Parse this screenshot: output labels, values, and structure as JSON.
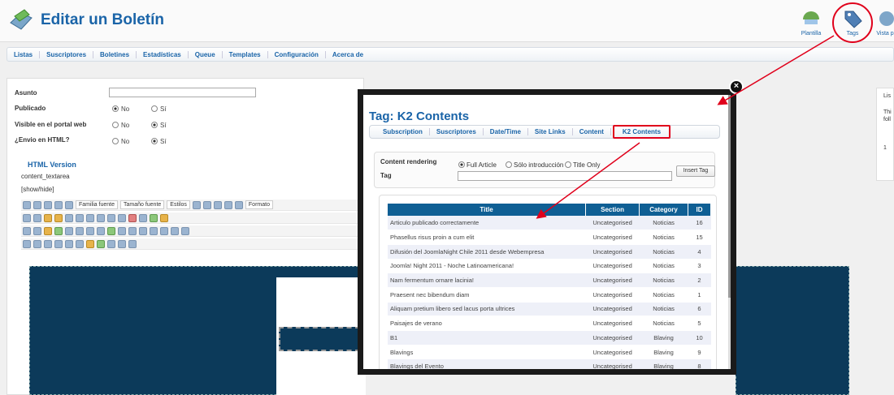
{
  "header": {
    "title": "Editar un Boletín",
    "toolbar": [
      {
        "label": "Plantilla"
      },
      {
        "label": "Tags"
      },
      {
        "label": "Vista p"
      }
    ]
  },
  "nav": [
    "Listas",
    "Suscriptores",
    "Boletines",
    "Estadísticas",
    "Queue",
    "Templates",
    "Configuración",
    "Acerca de"
  ],
  "form": {
    "asunto_label": "Asunto",
    "publicado_label": "Publicado",
    "visible_label": "Visible en el portal web",
    "envio_label": "¿Envio en HTML?",
    "no": "No",
    "si": "Sí",
    "html_version": "HTML Version",
    "content_textarea": "content_textarea",
    "show_hide": "[show/hide]",
    "editor_font": "Familia fuente",
    "editor_size": "Tamaño fuente",
    "editor_styles": "Estilos",
    "editor_format": "Formato"
  },
  "right_panel": {
    "label": "Lis",
    "text": "Thi",
    "text2": "foll",
    "num": "1"
  },
  "modal": {
    "title": "Tag: K2 Contents",
    "tabs": [
      "Subscription",
      "Suscriptores",
      "Date/Time",
      "Site Links",
      "Content",
      "K2 Contents"
    ],
    "content_rendering_label": "Content rendering",
    "tag_label": "Tag",
    "options": [
      "Full Article",
      "Sólo introducción",
      "Title Only"
    ],
    "insert_tag": "Insert Tag",
    "close": "×",
    "table": {
      "headers": [
        "Title",
        "Section",
        "Category",
        "ID"
      ],
      "rows": [
        [
          "Articulo publicado correctamente",
          "Uncategorised",
          "Noticias",
          "16"
        ],
        [
          "Phasellus risus proin a cum elit",
          "Uncategorised",
          "Noticias",
          "15"
        ],
        [
          "Difusión del JoomlaNight Chile 2011 desde Webempresa",
          "Uncategorised",
          "Noticias",
          "4"
        ],
        [
          "Joomla! Night 2011 - Noche Latinoamericana!",
          "Uncategorised",
          "Noticias",
          "3"
        ],
        [
          "Nam fermentum ornare lacinia!",
          "Uncategorised",
          "Noticias",
          "2"
        ],
        [
          "Praesent nec bibendum diam",
          "Uncategorised",
          "Noticias",
          "1"
        ],
        [
          "Aliquam pretium libero sed lacus porta ultrices",
          "Uncategorised",
          "Noticias",
          "6"
        ],
        [
          "Paisajes de verano",
          "Uncategorised",
          "Noticias",
          "5"
        ],
        [
          "B1",
          "Uncategorised",
          "Blaving",
          "10"
        ],
        [
          "Blavings",
          "Uncategorised",
          "Blaving",
          "9"
        ],
        [
          "Blavings del Evento",
          "Uncategorised",
          "Blaving",
          "8"
        ]
      ]
    }
  },
  "colors": {
    "accent": "#1a64a8",
    "highlight": "#e0001b",
    "table_header": "#0f5f94"
  }
}
